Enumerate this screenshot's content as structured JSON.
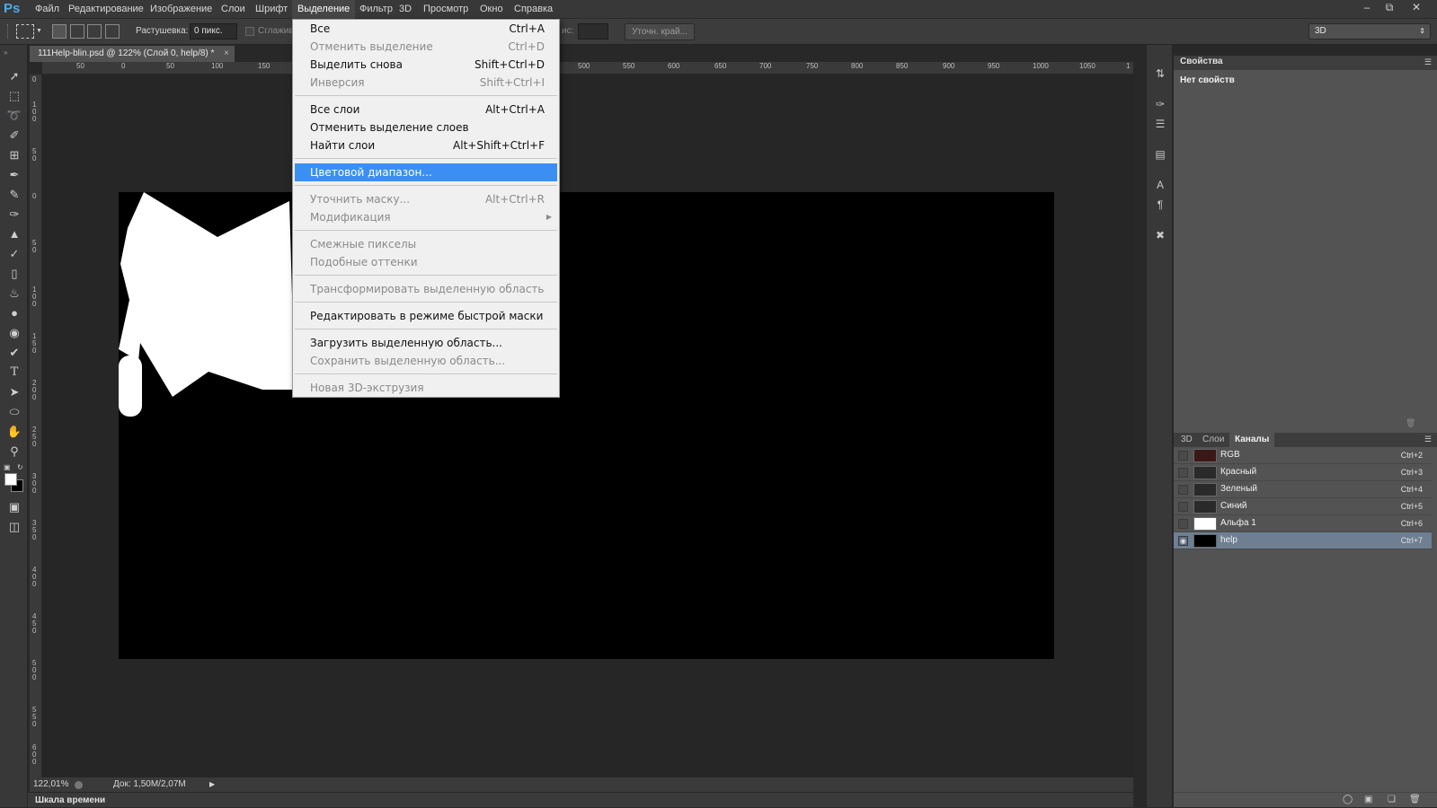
{
  "app": {
    "logo": "Ps"
  },
  "menubar": {
    "items": [
      "Файл",
      "Редактирование",
      "Изображение",
      "Слои",
      "Шрифт",
      "Выделение",
      "Фильтр",
      "3D",
      "Просмотр",
      "Окно",
      "Справка"
    ],
    "active": "Выделение"
  },
  "options": {
    "feather_label": "Растушевка:",
    "feather_value": "0 пикс.",
    "antialias_label": "Сглажив",
    "style_label": "ис:",
    "refine_edge": "Уточн. край...",
    "workspace": "3D"
  },
  "document": {
    "tab_title": "111Help-blin.psd @ 122% (Слой 0, help/8) *",
    "zoom": "122,01%",
    "doc_size": "Док: 1,50M/2,07M",
    "ruler_top": [
      "50",
      "0",
      "50",
      "100",
      "150",
      "500",
      "550",
      "600",
      "650",
      "700",
      "750",
      "800",
      "850",
      "900",
      "950",
      "1000",
      "1050",
      "1"
    ],
    "ruler_left": [
      "0",
      "1 0 0",
      "5 0",
      "0",
      "5 0",
      "1 0 0",
      "1 5 0",
      "2 0 0",
      "2 5 0",
      "3 0 0",
      "3 5 0",
      "4 0 0",
      "4 5 0",
      "5 0 0",
      "5 5 0",
      "6 0 0"
    ],
    "canvas_colors": {
      "background": "#000000",
      "shape": "#ffffff"
    }
  },
  "timeline": {
    "label": "Шкала времени"
  },
  "properties": {
    "title": "Свойства",
    "empty": "Нет свойств"
  },
  "channels_panel": {
    "tabs": [
      "3D",
      "Слои",
      "Каналы"
    ],
    "active_tab": "Каналы",
    "rows": [
      {
        "name": "RGB",
        "key": "Ctrl+2"
      },
      {
        "name": "Красный",
        "key": "Ctrl+3"
      },
      {
        "name": "Зеленый",
        "key": "Ctrl+4"
      },
      {
        "name": "Синий",
        "key": "Ctrl+5"
      },
      {
        "name": "Альфа 1",
        "key": "Ctrl+6"
      },
      {
        "name": "help",
        "key": "Ctrl+7",
        "selected": true
      }
    ]
  },
  "select_menu": {
    "items": [
      {
        "label": "Все",
        "key": "Ctrl+A",
        "enabled": true
      },
      {
        "label": "Отменить выделение",
        "key": "Ctrl+D",
        "enabled": false
      },
      {
        "label": "Выделить снова",
        "key": "Shift+Ctrl+D",
        "enabled": true
      },
      {
        "label": "Инверсия",
        "key": "Shift+Ctrl+I",
        "enabled": false
      },
      {
        "label": "Все слои",
        "key": "Alt+Ctrl+A",
        "enabled": true
      },
      {
        "label": "Отменить выделение слоев",
        "key": "",
        "enabled": true
      },
      {
        "label": "Найти слои",
        "key": "Alt+Shift+Ctrl+F",
        "enabled": true
      },
      {
        "label": "Цветовой диапазон...",
        "key": "",
        "enabled": true,
        "highlighted": true
      },
      {
        "label": "Уточнить маску...",
        "key": "Alt+Ctrl+R",
        "enabled": false
      },
      {
        "label": "Модификация",
        "key": "",
        "enabled": false,
        "submenu": true
      },
      {
        "label": "Смежные пикселы",
        "key": "",
        "enabled": false
      },
      {
        "label": "Подобные оттенки",
        "key": "",
        "enabled": false
      },
      {
        "label": "Трансформировать выделенную область",
        "key": "",
        "enabled": false
      },
      {
        "label": "Редактировать в режиме быстрой маски",
        "key": "",
        "enabled": true
      },
      {
        "label": "Загрузить выделенную область...",
        "key": "",
        "enabled": true
      },
      {
        "label": "Сохранить выделенную область...",
        "key": "",
        "enabled": false
      },
      {
        "label": "Новая 3D-экструзия",
        "key": "",
        "enabled": false
      }
    ],
    "highlight_color": "#3b8ff2"
  }
}
